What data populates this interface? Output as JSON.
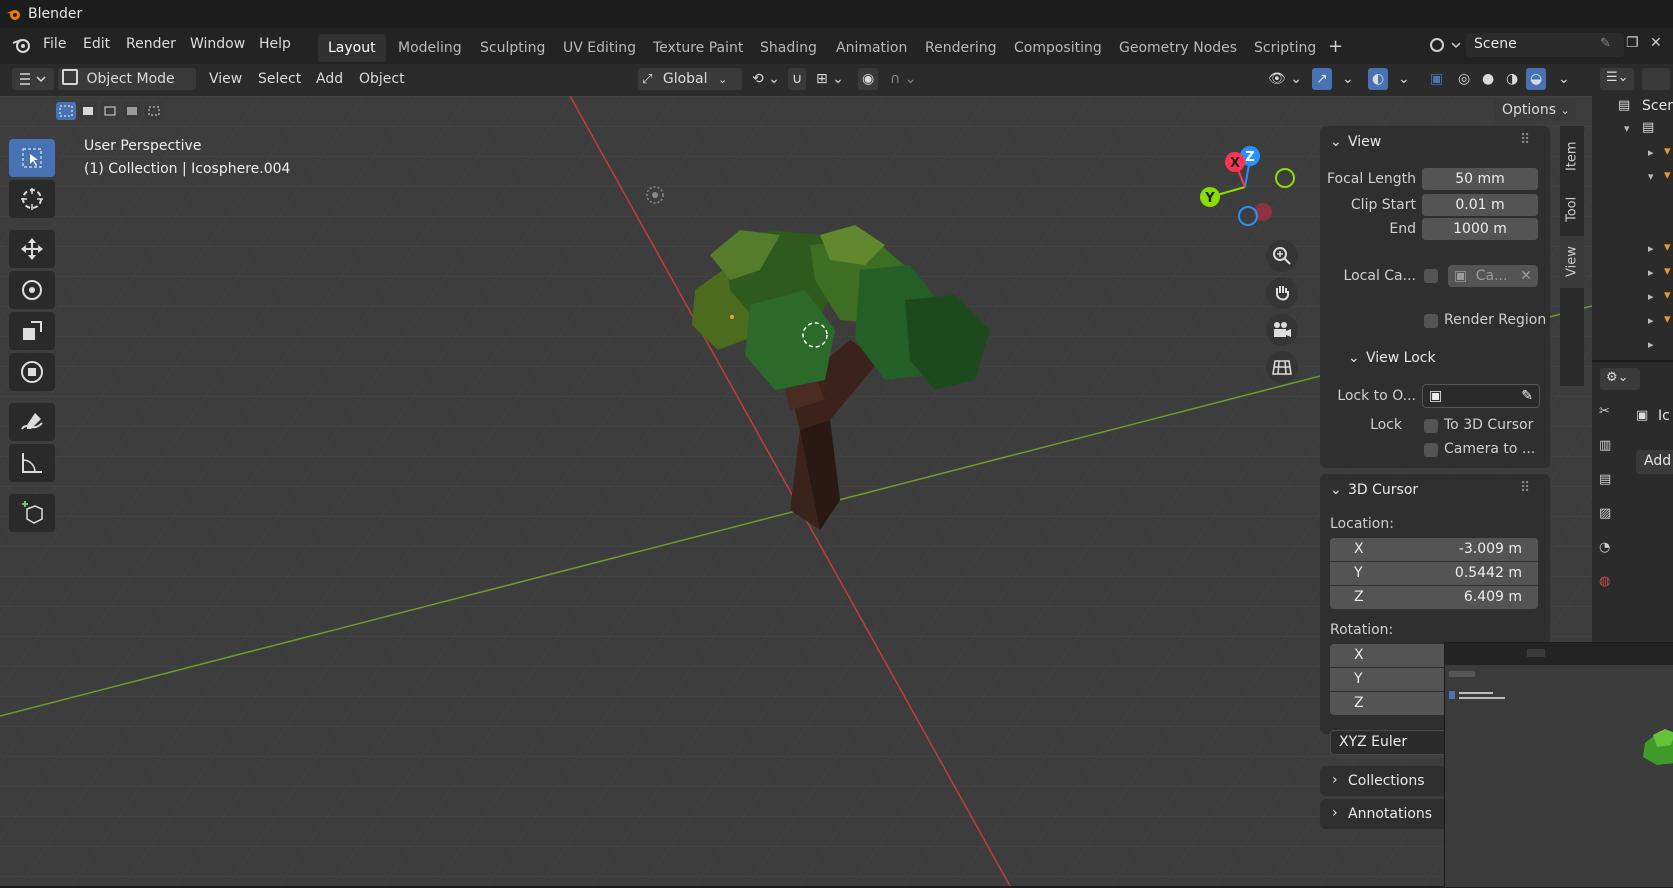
{
  "window": {
    "title": "Blender"
  },
  "menu": [
    "File",
    "Edit",
    "Render",
    "Window",
    "Help"
  ],
  "workspace_tabs": [
    {
      "label": "Layout",
      "active": true
    },
    {
      "label": "Modeling"
    },
    {
      "label": "Sculpting"
    },
    {
      "label": "UV Editing"
    },
    {
      "label": "Texture Paint"
    },
    {
      "label": "Shading"
    },
    {
      "label": "Animation"
    },
    {
      "label": "Rendering"
    },
    {
      "label": "Compositing"
    },
    {
      "label": "Geometry Nodes"
    },
    {
      "label": "Scripting"
    }
  ],
  "scene": {
    "name": "Scene"
  },
  "header": {
    "mode": "Object Mode",
    "view": "View",
    "select": "Select",
    "add": "Add",
    "object": "Object",
    "transform_orientation": "Global",
    "options": "Options"
  },
  "viewport": {
    "perspective_label": "User Perspective",
    "object_label": "(1) Collection | Icosphere.004",
    "gizmo_axes": {
      "x": "X",
      "y": "Y",
      "z": "Z"
    }
  },
  "npanel": {
    "tabs": [
      "Item",
      "Tool",
      "View"
    ],
    "view": {
      "title": "View",
      "focal_length_label": "Focal Length",
      "focal_length": "50 mm",
      "clip_start_label": "Clip Start",
      "clip_start": "0.01 m",
      "clip_end_label": "End",
      "clip_end": "1000 m",
      "local_camera_label": "Local Ca...",
      "local_camera_value": "Ca...",
      "render_region_label": "Render Region"
    },
    "view_lock": {
      "title": "View Lock",
      "lock_to_object_label": "Lock to O...",
      "lock_label": "Lock",
      "to_3d_cursor": "To 3D Cursor",
      "camera_to": "Camera to ..."
    },
    "cursor": {
      "title": "3D Cursor",
      "location_label": "Location:",
      "x_label": "X",
      "x": "-3.009 m",
      "y_label": "Y",
      "y": "0.5442 m",
      "z_label": "Z",
      "z": "6.409 m",
      "rotation_label": "Rotation:",
      "rx_label": "X",
      "ry_label": "Y",
      "rz_label": "Z",
      "rotation_mode": "XYZ Euler"
    },
    "collections": "Collections",
    "annotations": "Annotations"
  },
  "outliner": {
    "scene_label": "Scen"
  },
  "properties": {
    "object_name": "Ic",
    "add_button": "Add I"
  },
  "colors": {
    "accent": "#4772b3",
    "axis_x": "#ff3352",
    "axis_y": "#8bdc00",
    "axis_z": "#2890ff",
    "x_line": "#c43b3b",
    "y_line": "#6e9b2d"
  }
}
